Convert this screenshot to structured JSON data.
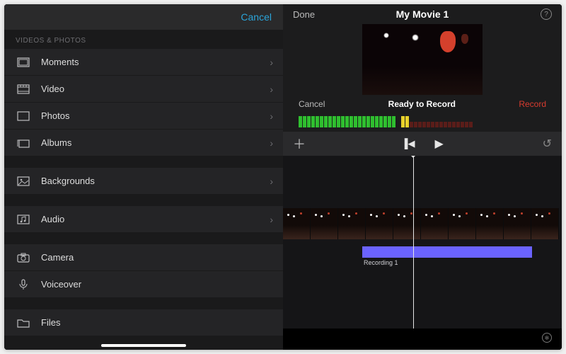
{
  "browser": {
    "cancel": "Cancel",
    "section_label": "VIDEOS & PHOTOS",
    "items": [
      {
        "label": "Moments",
        "icon": "moments-icon",
        "chevron": true
      },
      {
        "label": "Video",
        "icon": "video-icon",
        "chevron": true
      },
      {
        "label": "Photos",
        "icon": "photos-icon",
        "chevron": true
      },
      {
        "label": "Albums",
        "icon": "albums-icon",
        "chevron": true
      }
    ],
    "backgrounds": {
      "label": "Backgrounds",
      "chevron": true
    },
    "audio": {
      "label": "Audio",
      "chevron": true
    },
    "camera": {
      "label": "Camera"
    },
    "voiceover": {
      "label": "Voiceover"
    },
    "files": {
      "label": "Files"
    }
  },
  "editor": {
    "done": "Done",
    "title": "My Movie 1",
    "record_bar": {
      "cancel": "Cancel",
      "status": "Ready to Record",
      "record": "Record"
    },
    "audio_clip_label": "Recording 1"
  },
  "colors": {
    "accent_blue": "#2aa4d9",
    "record_red": "#d83b2f",
    "audio_purple": "#6b63ff"
  }
}
